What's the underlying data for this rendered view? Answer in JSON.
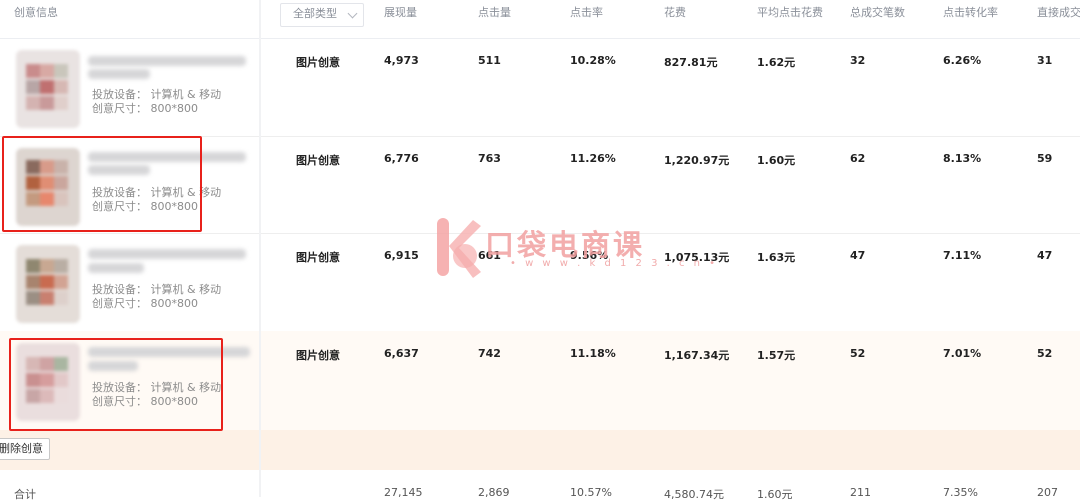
{
  "header": {
    "creative_info": "创意信息",
    "type_filter": "全部类型",
    "impressions": "展现量",
    "clicks": "点击量",
    "ctr": "点击率",
    "cost": "花费",
    "avg_cpc": "平均点击花费",
    "total_orders": "总成交笔数",
    "conversion_rate": "点击转化率",
    "direct_orders": "直接成交"
  },
  "rows": [
    {
      "device": "投放设备：  计算机 & 移动",
      "size": "创意尺寸：  800*800",
      "type": "图片创意",
      "impressions": "4,973",
      "clicks": "511",
      "ctr": "10.28%",
      "cost": "827.81元",
      "cpc": "1.62元",
      "orders": "32",
      "cvr": "6.26%",
      "direct": "31"
    },
    {
      "device": "投放设备：  计算机 & 移动",
      "size": "创意尺寸：  800*800",
      "type": "图片创意",
      "impressions": "6,776",
      "clicks": "763",
      "ctr": "11.26%",
      "cost": "1,220.97元",
      "cpc": "1.60元",
      "orders": "62",
      "cvr": "8.13%",
      "direct": "59"
    },
    {
      "device": "投放设备：  计算机 & 移动",
      "size": "创意尺寸：  800*800",
      "type": "图片创意",
      "impressions": "6,915",
      "clicks": "661",
      "ctr": "9.56%",
      "cost": "1,075.13元",
      "cpc": "1.63元",
      "orders": "47",
      "cvr": "7.11%",
      "direct": "47"
    },
    {
      "device": "投放设备：  计算机 & 移动",
      "size": "创意尺寸：  800*800",
      "type": "图片创意",
      "impressions": "6,637",
      "clicks": "742",
      "ctr": "11.18%",
      "cost": "1,167.34元",
      "cpc": "1.57元",
      "orders": "52",
      "cvr": "7.01%",
      "direct": "52"
    }
  ],
  "actions": {
    "delete": "删除创意"
  },
  "total": {
    "label": "合计",
    "impressions": "27,145",
    "clicks": "2,869",
    "ctr": "10.57%",
    "cost": "4,580.74元",
    "cpc": "1.60元",
    "orders": "211",
    "cvr": "7.35%",
    "direct": "207"
  },
  "watermark": {
    "brand": "口袋电商课",
    "url": "• w w w . k d 1 2 3 . c n •"
  },
  "colors": {
    "highlight_box": "#e8211b",
    "row_alt_bg": "#fffaf5",
    "action_band": "#fdf1e6"
  }
}
